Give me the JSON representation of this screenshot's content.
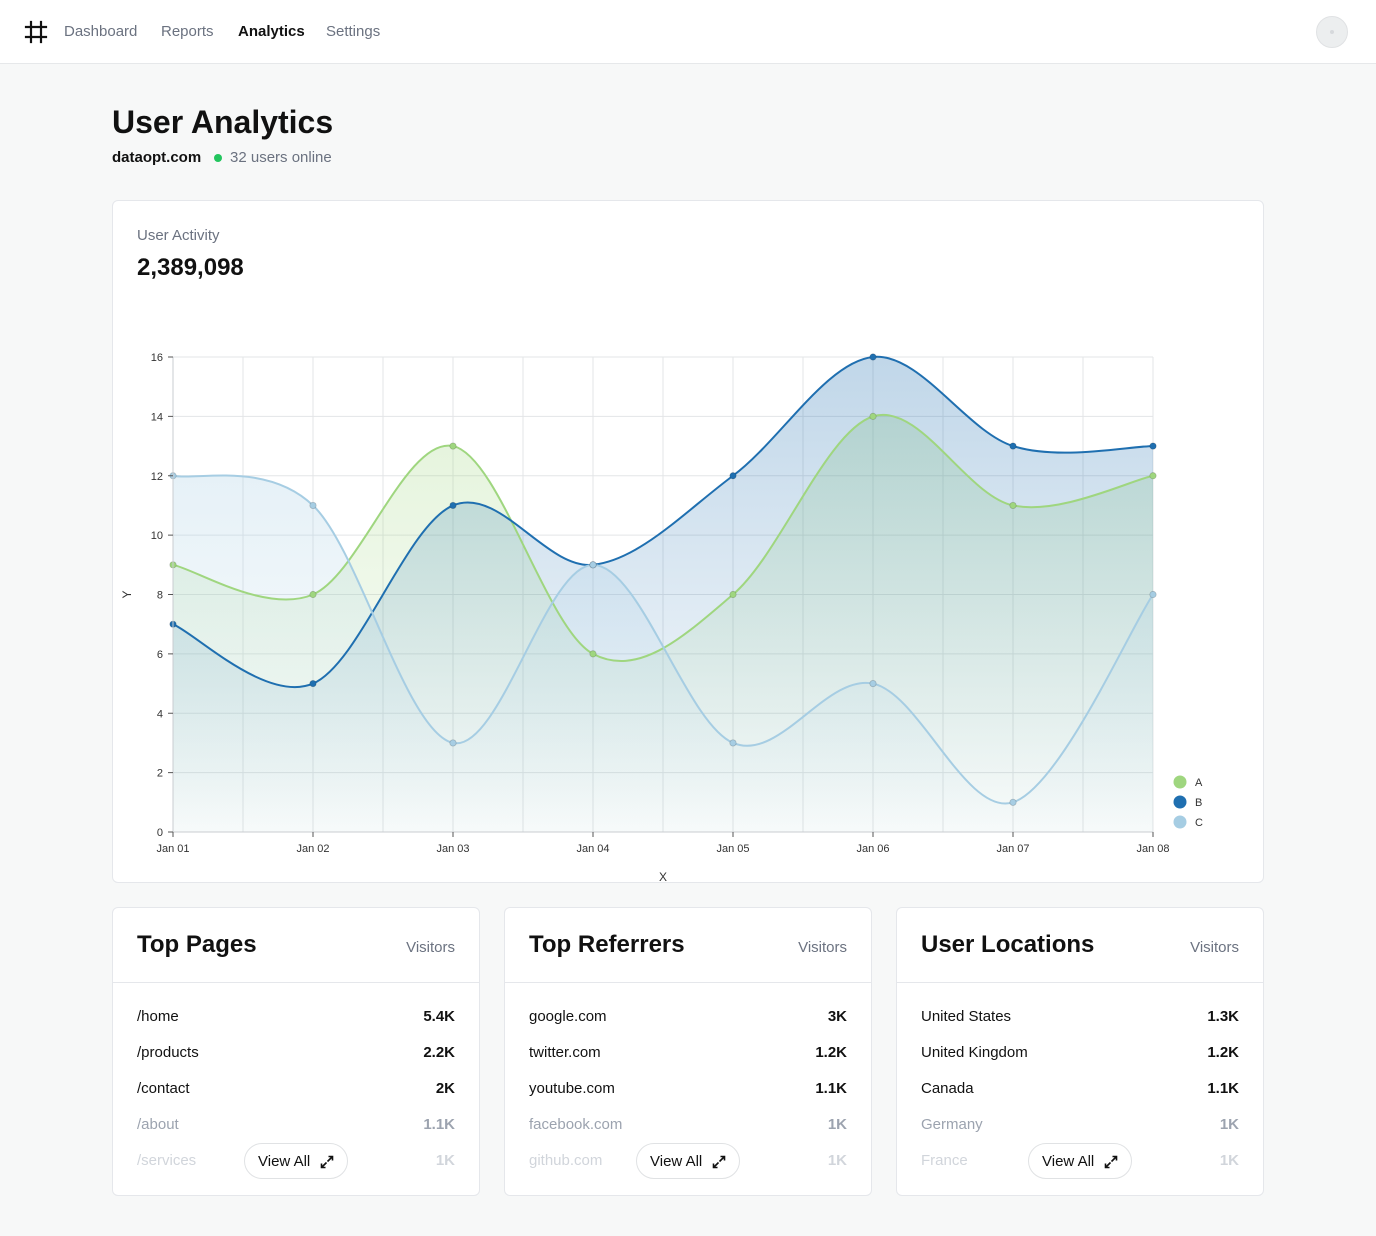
{
  "nav": {
    "logo_icon": "hash-icon",
    "links": [
      {
        "label": "Dashboard",
        "active": false
      },
      {
        "label": "Reports",
        "active": false
      },
      {
        "label": "Analytics",
        "active": true
      },
      {
        "label": "Settings",
        "active": false
      }
    ]
  },
  "header": {
    "title": "User Analytics",
    "site": "dataopt.com",
    "online": "32 users online",
    "online_color": "#22c55e"
  },
  "activity": {
    "label": "User Activity",
    "total": "2,389,098"
  },
  "chart_data": {
    "type": "area",
    "x": [
      "Jan 01",
      "Jan 02",
      "Jan 03",
      "Jan 04",
      "Jan 05",
      "Jan 06",
      "Jan 07",
      "Jan 08"
    ],
    "series": [
      {
        "name": "A",
        "values": [
          9,
          8,
          13,
          6,
          8,
          14,
          11,
          12
        ],
        "color": "#9fd67f"
      },
      {
        "name": "B",
        "values": [
          7,
          5,
          11,
          9,
          12,
          16,
          13,
          13
        ],
        "color": "#1f6fb0"
      },
      {
        "name": "C",
        "values": [
          12,
          11,
          3,
          9,
          3,
          5,
          1,
          8
        ],
        "color": "#a6cde3"
      }
    ],
    "xlabel": "X",
    "ylabel": "Y",
    "ylim": [
      0,
      16
    ],
    "yticks": [
      "0",
      "2",
      "4",
      "6",
      "8",
      "10",
      "12",
      "14",
      "16"
    ],
    "grid": true,
    "legend": "bottom-right"
  },
  "top_pages": {
    "title": "Top Pages",
    "column": "Visitors",
    "rows": [
      {
        "name": "/home",
        "value": "5.4K"
      },
      {
        "name": "/products",
        "value": "2.2K"
      },
      {
        "name": "/contact",
        "value": "2K"
      },
      {
        "name": "/about",
        "value": "1.1K"
      },
      {
        "name": "/services",
        "value": "1K"
      }
    ],
    "button": "View All"
  },
  "top_referrers": {
    "title": "Top Referrers",
    "column": "Visitors",
    "rows": [
      {
        "name": "google.com",
        "value": "3K"
      },
      {
        "name": "twitter.com",
        "value": "1.2K"
      },
      {
        "name": "youtube.com",
        "value": "1.1K"
      },
      {
        "name": "facebook.com",
        "value": "1K"
      },
      {
        "name": "github.com",
        "value": "1K"
      }
    ],
    "button": "View All"
  },
  "user_locations": {
    "title": "User Locations",
    "column": "Visitors",
    "rows": [
      {
        "name": "United States",
        "value": "1.3K"
      },
      {
        "name": "United Kingdom",
        "value": "1.2K"
      },
      {
        "name": "Canada",
        "value": "1.1K"
      },
      {
        "name": "Germany",
        "value": "1K"
      },
      {
        "name": "France",
        "value": "1K"
      }
    ],
    "button": "View All"
  }
}
